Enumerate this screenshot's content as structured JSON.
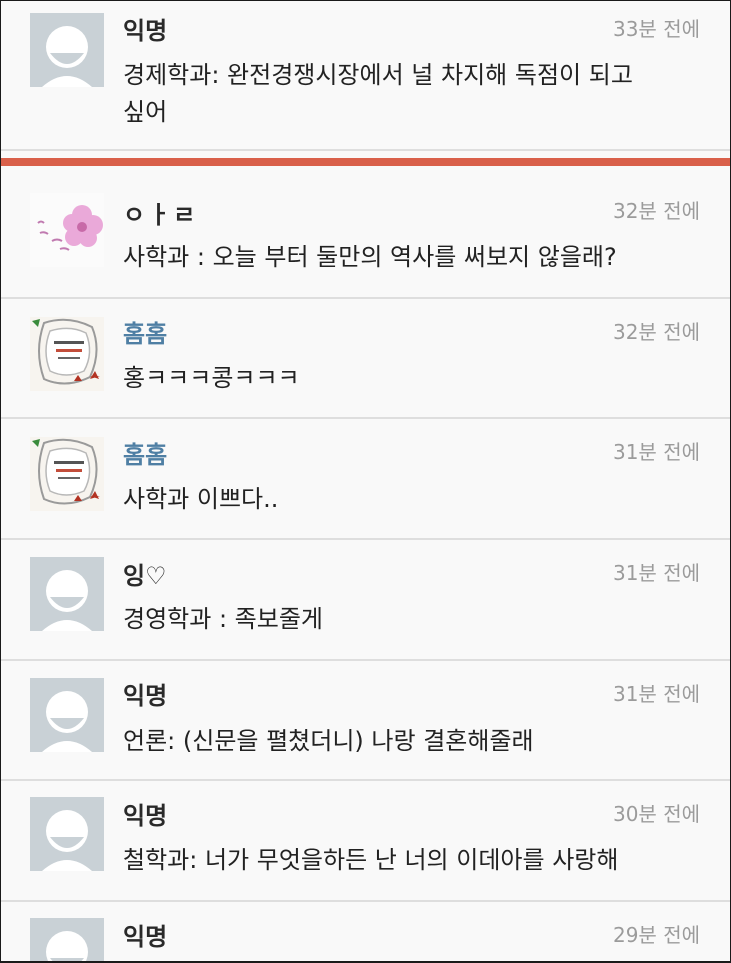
{
  "comments": [
    {
      "author": "익명",
      "time": "33분 전에",
      "text": "경제학과: 완전경쟁시장에서 널 차지해 독점이 되고 싶어",
      "avatar": "default-avatar-icon"
    },
    {
      "author": "ㅇㅏㄹ",
      "time": "32분 전에",
      "text": "사학과 : 오늘 부터 둘만의 역사를 써보지 않을래?",
      "avatar": "flower-avatar-icon"
    },
    {
      "author": "홈홈",
      "time": "32분 전에",
      "text": "홍ㅋㅋㅋ콩ㅋㅋㅋ",
      "avatar": "book-cover-avatar-icon"
    },
    {
      "author": "홈홈",
      "time": "31분 전에",
      "text": "사학과 이쁘다..",
      "avatar": "book-cover-avatar-icon"
    },
    {
      "author": "잉♡",
      "time": "31분 전에",
      "text": "경영학과 : 족보줄게",
      "avatar": "default-avatar-icon"
    },
    {
      "author": "익명",
      "time": "31분 전에",
      "text": "언론: (신문을 펼쳤더니) 나랑 결혼해줄래",
      "avatar": "default-avatar-icon"
    },
    {
      "author": "익명",
      "time": "30분 전에",
      "text": "철학과: 너가 무엇을하든 난 너의 이데아를 사랑해",
      "avatar": "default-avatar-icon"
    },
    {
      "author": "익명",
      "time": "29분 전에",
      "text": "",
      "avatar": "default-avatar-icon"
    }
  ],
  "colors": {
    "divider": "#d9604a",
    "author_link": "#4f7fa4",
    "timestamp": "#9b9b9b",
    "avatar_bg": "#c9d1d6"
  }
}
